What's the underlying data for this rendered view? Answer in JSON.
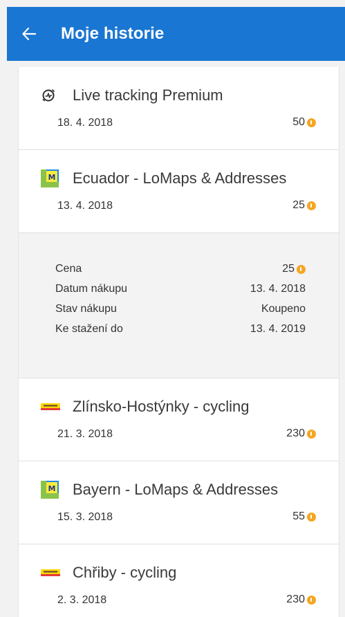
{
  "appbar": {
    "title": "Moje historie",
    "back_icon": "arrow-left-icon",
    "color": "#1976d2"
  },
  "purchases": [
    {
      "icon": "live-tracking-icon",
      "title": "Live tracking Premium",
      "date": "18. 4. 2018",
      "price": "50"
    },
    {
      "icon": "lomaps-icon",
      "title": "Ecuador - LoMaps & Addresses",
      "date": "13. 4. 2018",
      "price": "25"
    },
    {
      "icon": "shocart-icon",
      "title": "Zlínsko-Hostýnky - cycling",
      "date": "21. 3. 2018",
      "price": "230"
    },
    {
      "icon": "lomaps-icon",
      "title": "Bayern - LoMaps & Addresses",
      "date": "15. 3. 2018",
      "price": "55"
    },
    {
      "icon": "shocart-icon",
      "title": "Chřiby - cycling",
      "date": "2. 3. 2018",
      "price": "230"
    }
  ],
  "details": {
    "rows": [
      {
        "label": "Cena",
        "value": "25"
      },
      {
        "label": "Datum nákupu",
        "value": "13. 4. 2018"
      },
      {
        "label": "Stav nákupu",
        "value": "Koupeno"
      },
      {
        "label": "Ke stažení do",
        "value": "13. 4. 2019"
      }
    ]
  },
  "colors": {
    "coin": "#f5a623",
    "lomaps_blue": "#1e88e5",
    "lomaps_green": "#8bc34a",
    "shocart_yellow": "#ffd600"
  }
}
